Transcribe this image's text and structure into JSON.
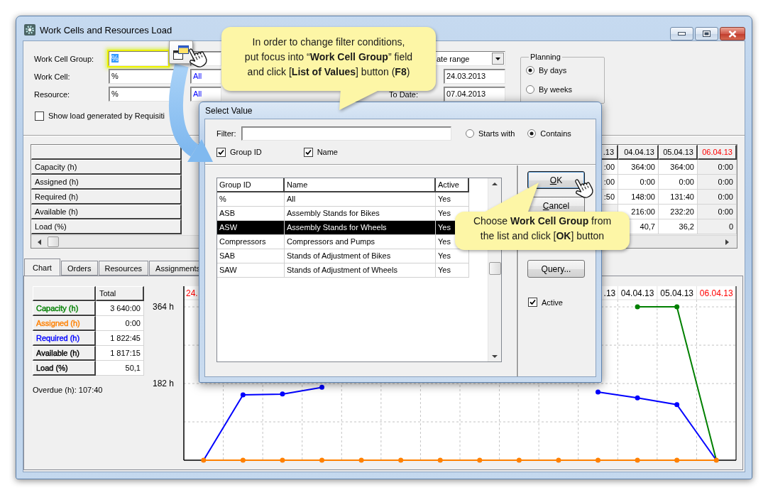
{
  "window": {
    "title": "Work Cells and Resources Load"
  },
  "filters": {
    "fields": [
      {
        "label": "Work Cell Group:",
        "value": "%",
        "focused": true
      },
      {
        "label": "Work Cell:",
        "value": "%",
        "focused": false,
        "description": "All"
      },
      {
        "label": "Resource:",
        "value": "%",
        "focused": false,
        "description": "All"
      }
    ],
    "period": {
      "value": "ate range"
    },
    "from_date": {
      "value": "24.03.2013"
    },
    "to_date": {
      "label": "To Date:",
      "value": "07.04.2013"
    },
    "show_requisitions": {
      "label": "Show load generated by Requisiti",
      "checked": false
    },
    "planning": {
      "title": "Planning",
      "options": [
        {
          "label": "By days",
          "selected": true
        },
        {
          "label": "By weeks",
          "selected": false
        }
      ]
    }
  },
  "load_grid": {
    "row_headers": [
      "Capacity (h)",
      "Assigned (h)",
      "Required (h)",
      "Available (h)",
      "Load (%)"
    ],
    "columns": [
      {
        "label": ".13",
        "weekend": false,
        "cells": [
          ":00",
          ":00",
          ":50"
        ]
      },
      {
        "label": "04.04.13",
        "weekend": false,
        "cells": [
          "364:00",
          "0:00",
          "148:00",
          "216:00",
          "40,7"
        ]
      },
      {
        "label": "05.04.13",
        "weekend": false,
        "cells": [
          "364:00",
          "0:00",
          "131:40",
          "232:20",
          "36,2"
        ]
      },
      {
        "label": "06.04.13",
        "weekend": true,
        "cells": [
          "0:00",
          "0:00",
          "0:00",
          "0:00",
          "0"
        ]
      }
    ]
  },
  "tabs": [
    {
      "label": "Chart",
      "selected": true
    },
    {
      "label": "Orders",
      "selected": false
    },
    {
      "label": "Resources",
      "selected": false
    },
    {
      "label": "Assignments",
      "selected": false
    }
  ],
  "chart_tab": {
    "summary": {
      "header": "Total",
      "rows": [
        {
          "label": "Capacity (h)",
          "total": "3 640:00",
          "color": "#008000"
        },
        {
          "label": "Assigned (h)",
          "total": "0:00",
          "color": "#ff8000"
        },
        {
          "label": "Required (h)",
          "total": "1 822:45",
          "color": "#0000ff"
        },
        {
          "label": "Available (h)",
          "total": "1 817:15",
          "color": "#000000"
        },
        {
          "label": "Load (%)",
          "total": "50,1",
          "color": "#000000"
        }
      ]
    },
    "overdue": "Overdue (h): 107:40",
    "clipped_date_labels": [
      {
        "text": "24.",
        "weekend": true
      },
      {
        "text": ".13",
        "weekend": false
      }
    ],
    "chart_data": {
      "type": "line",
      "categories": [
        null,
        null,
        null,
        null,
        null,
        null,
        null,
        null,
        null,
        null,
        null,
        "04.04.13",
        "05.04.13",
        "06.04.13"
      ],
      "series": [
        {
          "color": "#008000",
          "marker": "circle",
          "values": [
            null,
            null,
            null,
            null,
            null,
            null,
            null,
            null,
            null,
            null,
            null,
            364,
            364,
            0
          ]
        },
        {
          "color": "#0000ff",
          "marker": "circle",
          "values": [
            0,
            155,
            157,
            173,
            null,
            null,
            null,
            null,
            null,
            null,
            162,
            148,
            132,
            0
          ]
        },
        {
          "color": "#ff8000",
          "marker": "circle",
          "values": [
            0,
            0,
            0,
            0,
            0,
            0,
            0,
            0,
            0,
            0,
            0,
            0,
            0,
            0
          ]
        }
      ],
      "ylim": [
        0,
        413
      ],
      "yticks": [
        {
          "value": 182,
          "label": "182 h"
        },
        {
          "value": 364,
          "label": "364 h"
        }
      ]
    },
    "weekend": [
      false,
      false,
      true
    ]
  },
  "select_value_dialog": {
    "title": "Select Value",
    "filter_label": "Filter:",
    "match_options": [
      {
        "label": "Starts with",
        "selected": false
      },
      {
        "label": "Contains",
        "selected": true
      }
    ],
    "column_toggles": [
      {
        "label": "Group ID",
        "checked": true
      },
      {
        "label": "Name",
        "checked": true
      }
    ],
    "columns": [
      "Group ID",
      "Name",
      "Active"
    ],
    "rows": [
      {
        "cells": [
          "%",
          "All",
          "Yes"
        ],
        "selected": false
      },
      {
        "cells": [
          "ASB",
          "Assembly Stands for Bikes",
          "Yes"
        ],
        "selected": false
      },
      {
        "cells": [
          "ASW",
          "Assembly Stands for Wheels",
          "Yes"
        ],
        "selected": true
      },
      {
        "cells": [
          "Compressors",
          "Compressors and Pumps",
          "Yes"
        ],
        "selected": false
      },
      {
        "cells": [
          "SAB",
          "Stands of Adjustment of Bikes",
          "Yes"
        ],
        "selected": false
      },
      {
        "cells": [
          "SAW",
          "Stands of Adjustment of Wheels",
          "Yes"
        ],
        "selected": false
      }
    ],
    "buttons": [
      {
        "label": "OK",
        "default": true,
        "mnemonic": true
      },
      {
        "label": "Cancel",
        "default": false,
        "mnemonic": true
      },
      {
        "label": "Query...",
        "default": false,
        "mnemonic": false
      }
    ],
    "active_filter": {
      "label": "Active",
      "checked": true
    }
  },
  "callouts": [
    {
      "text": "In order to change filter conditions,\nput focus into “**Work Cell Group**” field\nand click [**List of Values**] button (**F8**)"
    },
    {
      "text": "Choose **Work Cell Group** from\nthe list and click [**OK**] button"
    }
  ]
}
